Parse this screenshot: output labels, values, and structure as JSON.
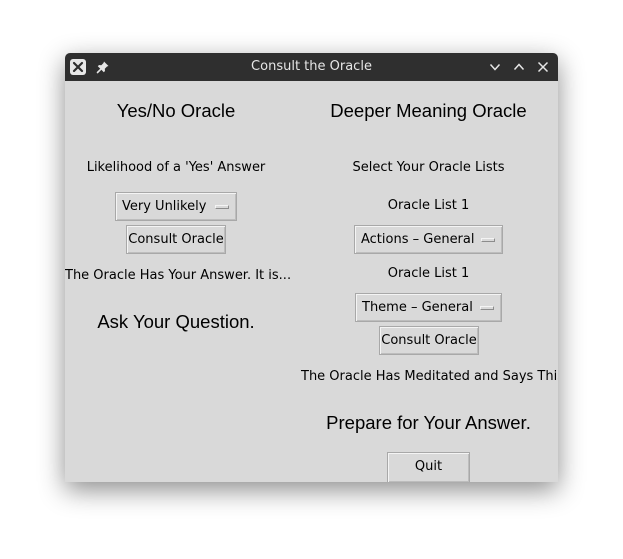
{
  "window": {
    "title": "Consult the Oracle"
  },
  "yes_no": {
    "heading": "Yes/No Oracle",
    "likelihood_label": "Likelihood of a 'Yes' Answer",
    "likelihood_value": "Very Unlikely",
    "consult_label": "Consult Oracle",
    "answer_label": "The Oracle Has Your Answer.  It is...",
    "answer_text": "Ask Your Question."
  },
  "deeper": {
    "heading": "Deeper Meaning Oracle",
    "select_label": "Select Your Oracle Lists",
    "list1_label": "Oracle List 1",
    "list1_value": "Actions – General",
    "list2_label": "Oracle List 1",
    "list2_value": "Theme – General",
    "consult_label": "Consult Oracle",
    "meditated_label": "The Oracle Has Meditated and Says This...",
    "answer_text": "Prepare for Your Answer."
  },
  "quit_label": "Quit",
  "icons": {
    "close": "close-icon",
    "pin": "pin-icon",
    "minimize": "chevron-down-icon",
    "maximize": "chevron-up-icon",
    "close_right": "close-icon"
  }
}
